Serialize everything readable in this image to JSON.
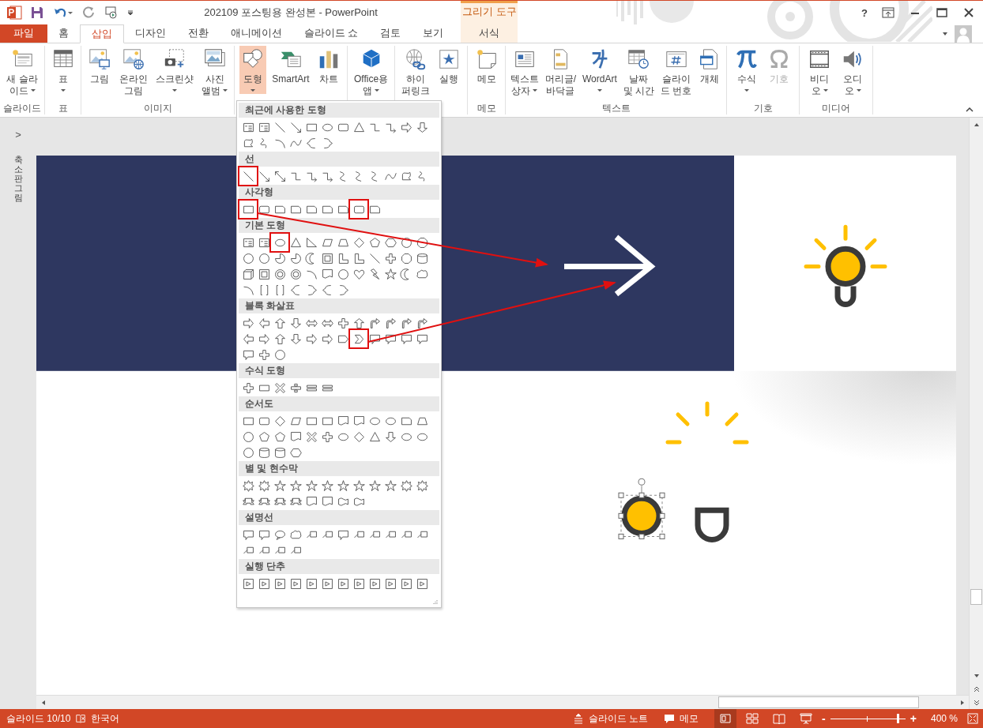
{
  "window": {
    "title": "202109 포스팅용 완성본 - PowerPoint",
    "help": "?"
  },
  "contextual": {
    "title": "그리기 도구"
  },
  "tabs": [
    {
      "label": "파일",
      "kind": "file",
      "selected": false
    },
    {
      "label": "홈",
      "kind": "tab",
      "selected": false
    },
    {
      "label": "삽입",
      "kind": "tab",
      "selected": true
    },
    {
      "label": "디자인",
      "kind": "tab",
      "selected": false
    },
    {
      "label": "전환",
      "kind": "tab",
      "selected": false
    },
    {
      "label": "애니메이션",
      "kind": "tab",
      "selected": false
    },
    {
      "label": "슬라이드 쇼",
      "kind": "tab",
      "selected": false
    },
    {
      "label": "검토",
      "kind": "tab",
      "selected": false
    },
    {
      "label": "보기",
      "kind": "tab",
      "selected": false
    },
    {
      "label": "서식",
      "kind": "context",
      "selected": false
    }
  ],
  "ribbon": [
    {
      "label": "슬라이드",
      "buttons": [
        {
          "kind": "newslide",
          "lines": [
            "새 슬라",
            "이드"
          ],
          "dropdown": true,
          "pressed": false,
          "disabled": false
        }
      ]
    },
    {
      "label": "표",
      "buttons": [
        {
          "kind": "table",
          "lines": [
            "표"
          ],
          "dropdown": true,
          "pressed": false,
          "disabled": false
        }
      ]
    },
    {
      "label": "이미지",
      "buttons": [
        {
          "kind": "picture",
          "lines": [
            "그림"
          ],
          "dropdown": false,
          "pressed": false,
          "disabled": false
        },
        {
          "kind": "online",
          "lines": [
            "온라인",
            "그림"
          ],
          "dropdown": false,
          "pressed": false,
          "disabled": false
        },
        {
          "kind": "screenshot",
          "lines": [
            "스크린샷"
          ],
          "dropdown": true,
          "pressed": false,
          "disabled": false
        },
        {
          "kind": "album",
          "lines": [
            "사진",
            "앨범"
          ],
          "dropdown": true,
          "pressed": false,
          "disabled": false
        }
      ]
    },
    {
      "buttons": [
        {
          "kind": "shapes",
          "lines": [
            "도형"
          ],
          "dropdown": true,
          "pressed": true,
          "disabled": false
        },
        {
          "kind": "smartart",
          "lines": [
            "SmartArt"
          ],
          "dropdown": false,
          "pressed": false,
          "disabled": false
        },
        {
          "kind": "chart",
          "lines": [
            "차트"
          ],
          "dropdown": false,
          "pressed": false,
          "disabled": false
        }
      ]
    },
    {
      "buttons": [
        {
          "kind": "store",
          "lines": [
            "Office용",
            "앱"
          ],
          "dropdown": true,
          "pressed": false,
          "disabled": false
        }
      ]
    },
    {
      "buttons": [
        {
          "kind": "link",
          "lines": [
            "하이",
            "퍼링크"
          ],
          "dropdown": false,
          "pressed": false,
          "disabled": false
        },
        {
          "kind": "action",
          "lines": [
            "실행"
          ],
          "dropdown": false,
          "pressed": false,
          "disabled": false
        }
      ]
    },
    {
      "label": "메모",
      "buttons": [
        {
          "kind": "comment",
          "lines": [
            "메모"
          ],
          "dropdown": false,
          "pressed": false,
          "disabled": false
        }
      ]
    },
    {
      "label": "텍스트",
      "buttons": [
        {
          "kind": "textbox",
          "lines": [
            "텍스트",
            "상자"
          ],
          "dropdown": true,
          "pressed": false,
          "disabled": false
        },
        {
          "kind": "header",
          "lines": [
            "머리글/",
            "바닥글"
          ],
          "dropdown": false,
          "pressed": false,
          "disabled": false
        },
        {
          "kind": "wordart",
          "lines": [
            "WordArt"
          ],
          "dropdown": true,
          "pressed": false,
          "disabled": false
        },
        {
          "kind": "date",
          "lines": [
            "날짜",
            "및 시간"
          ],
          "dropdown": false,
          "pressed": false,
          "disabled": false
        },
        {
          "kind": "slidenum",
          "lines": [
            "슬라이",
            "드 번호"
          ],
          "dropdown": false,
          "pressed": false,
          "disabled": false
        },
        {
          "kind": "object",
          "lines": [
            "개체"
          ],
          "dropdown": false,
          "pressed": false,
          "disabled": false
        }
      ]
    },
    {
      "label": "기호",
      "buttons": [
        {
          "kind": "pi",
          "lines": [
            "수식"
          ],
          "dropdown": true,
          "pressed": false,
          "disabled": false
        },
        {
          "kind": "omega",
          "lines": [
            "기호"
          ],
          "dropdown": false,
          "pressed": false,
          "disabled": true
        }
      ]
    },
    {
      "label": "미디어",
      "buttons": [
        {
          "kind": "video",
          "lines": [
            "비디",
            "오"
          ],
          "dropdown": true,
          "pressed": false,
          "disabled": false
        },
        {
          "kind": "audio",
          "lines": [
            "오디",
            "오"
          ],
          "dropdown": true,
          "pressed": false,
          "disabled": false
        }
      ]
    }
  ],
  "shapes_gallery": [
    {
      "title": "최근에 사용한 도형",
      "shapes": [
        {
          "kind": "tb",
          "marked": false
        },
        {
          "kind": "tb",
          "marked": false
        },
        {
          "kind": "ln",
          "marked": false
        },
        {
          "kind": "la",
          "marked": false
        },
        {
          "kind": "rc",
          "marked": false
        },
        {
          "kind": "ov",
          "marked": false
        },
        {
          "kind": "rr",
          "marked": false
        },
        {
          "kind": "tr",
          "marked": false
        },
        {
          "kind": "el",
          "marked": false
        },
        {
          "kind": "ea",
          "marked": false
        },
        {
          "kind": "ar",
          "marked": false
        },
        {
          "kind": "ad",
          "marked": false
        },
        {
          "kind": "fr",
          "marked": false
        },
        {
          "kind": "sc",
          "marked": false
        },
        {
          "kind": "ac",
          "marked": false
        },
        {
          "kind": "cv",
          "marked": false
        },
        {
          "kind": "lb",
          "marked": false
        },
        {
          "kind": "rb",
          "marked": false
        }
      ]
    },
    {
      "title": "선",
      "shapes": [
        {
          "kind": "ln",
          "marked": true
        },
        {
          "kind": "la",
          "marked": false
        },
        {
          "kind": "dl",
          "marked": false
        },
        {
          "kind": "el",
          "marked": false
        },
        {
          "kind": "ea",
          "marked": false
        },
        {
          "kind": "ea",
          "marked": false
        },
        {
          "kind": "cu",
          "marked": false
        },
        {
          "kind": "cu",
          "marked": false
        },
        {
          "kind": "cu",
          "marked": false
        },
        {
          "kind": "cv",
          "marked": false
        },
        {
          "kind": "fr",
          "marked": false
        },
        {
          "kind": "sc",
          "marked": false
        }
      ]
    },
    {
      "title": "사각형",
      "shapes": [
        {
          "kind": "rc",
          "marked": true
        },
        {
          "kind": "rr",
          "marked": false
        },
        {
          "kind": "sn",
          "marked": false
        },
        {
          "kind": "sn",
          "marked": false
        },
        {
          "kind": "sn",
          "marked": false
        },
        {
          "kind": "sn",
          "marked": false
        },
        {
          "kind": "sn",
          "marked": false
        },
        {
          "kind": "rr",
          "marked": true
        },
        {
          "kind": "sn",
          "marked": false
        }
      ]
    },
    {
      "title": "기본 도형",
      "shapes": [
        {
          "kind": "tb",
          "marked": false
        },
        {
          "kind": "tb",
          "marked": false
        },
        {
          "kind": "ov",
          "marked": true
        },
        {
          "kind": "tr",
          "marked": false
        },
        {
          "kind": "rt",
          "marked": false
        },
        {
          "kind": "pa",
          "marked": false
        },
        {
          "kind": "tz",
          "marked": false
        },
        {
          "kind": "di",
          "marked": false
        },
        {
          "kind": "pe",
          "marked": false
        },
        {
          "kind": "hx",
          "marked": false
        },
        {
          "kind": "ci",
          "marked": false
        },
        {
          "kind": "oc",
          "marked": false
        },
        {
          "kind": "ci",
          "marked": false
        },
        {
          "kind": "ci",
          "marked": false
        },
        {
          "kind": "pi",
          "marked": false
        },
        {
          "kind": "pi",
          "marked": false
        },
        {
          "kind": "mo",
          "marked": false
        },
        {
          "kind": "fo",
          "marked": false
        },
        {
          "kind": "lsh",
          "marked": false
        },
        {
          "kind": "lsh",
          "marked": false
        },
        {
          "kind": "ln",
          "marked": false
        },
        {
          "kind": "pl",
          "marked": false
        },
        {
          "kind": "oc",
          "marked": false
        },
        {
          "kind": "cy",
          "marked": false
        },
        {
          "kind": "cb",
          "marked": false
        },
        {
          "kind": "fo",
          "marked": false
        },
        {
          "kind": "dn",
          "marked": false
        },
        {
          "kind": "dn",
          "marked": false
        },
        {
          "kind": "ac",
          "marked": false
        },
        {
          "kind": "doc",
          "marked": false
        },
        {
          "kind": "ci",
          "marked": false
        },
        {
          "kind": "he",
          "marked": false
        },
        {
          "kind": "bo",
          "marked": false
        },
        {
          "kind": "st",
          "marked": false
        },
        {
          "kind": "mo",
          "marked": false
        },
        {
          "kind": "cl",
          "marked": false
        },
        {
          "kind": "ac",
          "marked": false
        },
        {
          "kind": "bk",
          "marked": false
        },
        {
          "kind": "bk",
          "marked": false
        },
        {
          "kind": "lb",
          "marked": false
        },
        {
          "kind": "rb",
          "marked": false
        },
        {
          "kind": "lb",
          "marked": false
        },
        {
          "kind": "rb",
          "marked": false
        }
      ]
    },
    {
      "title": "블록 화살표",
      "shapes": [
        {
          "kind": "ar",
          "marked": false
        },
        {
          "kind": "al",
          "marked": false
        },
        {
          "kind": "au",
          "marked": false
        },
        {
          "kind": "ad",
          "marked": false
        },
        {
          "kind": "alr",
          "marked": false
        },
        {
          "kind": "alr",
          "marked": false
        },
        {
          "kind": "pl",
          "marked": false
        },
        {
          "kind": "au",
          "marked": false
        },
        {
          "kind": "be",
          "marked": false
        },
        {
          "kind": "be",
          "marked": false
        },
        {
          "kind": "be",
          "marked": false
        },
        {
          "kind": "be",
          "marked": false
        },
        {
          "kind": "al",
          "marked": false
        },
        {
          "kind": "ar",
          "marked": false
        },
        {
          "kind": "au",
          "marked": false
        },
        {
          "kind": "ad",
          "marked": false
        },
        {
          "kind": "ar",
          "marked": false
        },
        {
          "kind": "ar",
          "marked": false
        },
        {
          "kind": "pent",
          "marked": false
        },
        {
          "kind": "chev",
          "marked": true
        },
        {
          "kind": "co",
          "marked": false
        },
        {
          "kind": "co",
          "marked": false
        },
        {
          "kind": "co",
          "marked": false
        },
        {
          "kind": "co",
          "marked": false
        },
        {
          "kind": "co",
          "marked": false
        },
        {
          "kind": "pl",
          "marked": false
        },
        {
          "kind": "ci",
          "marked": false
        }
      ]
    },
    {
      "title": "수식 도형",
      "shapes": [
        {
          "kind": "pl",
          "marked": false
        },
        {
          "kind": "mi",
          "marked": false
        },
        {
          "kind": "ti",
          "marked": false
        },
        {
          "kind": "dv",
          "marked": false
        },
        {
          "kind": "eq",
          "marked": false
        },
        {
          "kind": "eq",
          "marked": false
        }
      ]
    },
    {
      "title": "순서도",
      "shapes": [
        {
          "kind": "rc",
          "marked": false
        },
        {
          "kind": "rr",
          "marked": false
        },
        {
          "kind": "di",
          "marked": false
        },
        {
          "kind": "pa",
          "marked": false
        },
        {
          "kind": "rc",
          "marked": false
        },
        {
          "kind": "rc",
          "marked": false
        },
        {
          "kind": "doc",
          "marked": false
        },
        {
          "kind": "doc",
          "marked": false
        },
        {
          "kind": "ov",
          "marked": false
        },
        {
          "kind": "ov",
          "marked": false
        },
        {
          "kind": "sn",
          "marked": false
        },
        {
          "kind": "tz",
          "marked": false
        },
        {
          "kind": "ci",
          "marked": false
        },
        {
          "kind": "pe",
          "marked": false
        },
        {
          "kind": "pe",
          "marked": false
        },
        {
          "kind": "doc",
          "marked": false
        },
        {
          "kind": "ti",
          "marked": false
        },
        {
          "kind": "pl",
          "marked": false
        },
        {
          "kind": "ov",
          "marked": false
        },
        {
          "kind": "di",
          "marked": false
        },
        {
          "kind": "tr",
          "marked": false
        },
        {
          "kind": "ad",
          "marked": false
        },
        {
          "kind": "ov",
          "marked": false
        },
        {
          "kind": "ov",
          "marked": false
        },
        {
          "kind": "ci",
          "marked": false
        },
        {
          "kind": "cy",
          "marked": false
        },
        {
          "kind": "cy",
          "marked": false
        },
        {
          "kind": "hx",
          "marked": false
        }
      ]
    },
    {
      "title": "별 및 현수막",
      "shapes": [
        {
          "kind": "bu",
          "marked": false
        },
        {
          "kind": "bu",
          "marked": false
        },
        {
          "kind": "st",
          "marked": false
        },
        {
          "kind": "st",
          "marked": false
        },
        {
          "kind": "st",
          "marked": false
        },
        {
          "kind": "st",
          "marked": false
        },
        {
          "kind": "st",
          "marked": false
        },
        {
          "kind": "st",
          "marked": false
        },
        {
          "kind": "st",
          "marked": false
        },
        {
          "kind": "st",
          "marked": false
        },
        {
          "kind": "bu",
          "marked": false
        },
        {
          "kind": "bu",
          "marked": false
        },
        {
          "kind": "rib",
          "marked": false
        },
        {
          "kind": "rib",
          "marked": false
        },
        {
          "kind": "rib",
          "marked": false
        },
        {
          "kind": "rib",
          "marked": false
        },
        {
          "kind": "doc",
          "marked": false
        },
        {
          "kind": "doc",
          "marked": false
        },
        {
          "kind": "wv",
          "marked": false
        },
        {
          "kind": "wv",
          "marked": false
        }
      ]
    },
    {
      "title": "설명선",
      "shapes": [
        {
          "kind": "co",
          "marked": false
        },
        {
          "kind": "co",
          "marked": false
        },
        {
          "kind": "cov",
          "marked": false
        },
        {
          "kind": "cl",
          "marked": false
        },
        {
          "kind": "lc",
          "marked": false
        },
        {
          "kind": "lc",
          "marked": false
        },
        {
          "kind": "co",
          "marked": false
        },
        {
          "kind": "lc",
          "marked": false
        },
        {
          "kind": "lc",
          "marked": false
        },
        {
          "kind": "lc",
          "marked": false
        },
        {
          "kind": "lc",
          "marked": false
        },
        {
          "kind": "lc",
          "marked": false
        },
        {
          "kind": "lc",
          "marked": false
        },
        {
          "kind": "lc",
          "marked": false
        },
        {
          "kind": "lc",
          "marked": false
        },
        {
          "kind": "lc",
          "marked": false
        }
      ]
    },
    {
      "title": "실행 단추",
      "shapes": [
        {
          "kind": "ab",
          "marked": false
        },
        {
          "kind": "ab",
          "marked": false
        },
        {
          "kind": "ab",
          "marked": false
        },
        {
          "kind": "ab",
          "marked": false
        },
        {
          "kind": "ab",
          "marked": false
        },
        {
          "kind": "ab",
          "marked": false
        },
        {
          "kind": "ab",
          "marked": false
        },
        {
          "kind": "ab",
          "marked": false
        },
        {
          "kind": "ab",
          "marked": false
        },
        {
          "kind": "ab",
          "marked": false
        },
        {
          "kind": "ab",
          "marked": false
        },
        {
          "kind": "ab",
          "marked": false
        }
      ]
    }
  ],
  "thumbnail_pane": {
    "expand": ">",
    "label": "축소판 그림"
  },
  "status_bar": {
    "slide": "슬라이드 10/10",
    "language": "한국어",
    "notes": "슬라이드 노트",
    "comments": "메모",
    "views": [
      {
        "kind": "normal",
        "selected": true
      },
      {
        "kind": "sorter",
        "selected": false
      },
      {
        "kind": "reading",
        "selected": false
      },
      {
        "kind": "show",
        "selected": false
      }
    ],
    "zoom_out": "-",
    "zoom_in": "+",
    "zoom": {
      "level": 0.92
    },
    "zoom_reading": "400 %"
  }
}
